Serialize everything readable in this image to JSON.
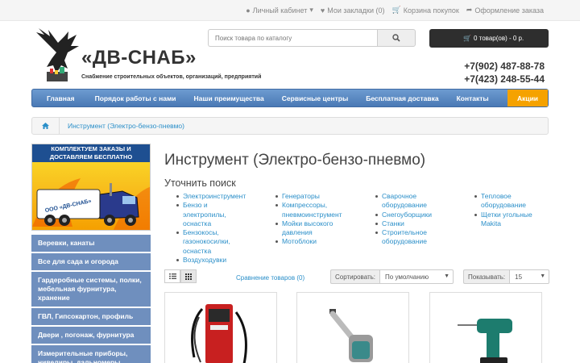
{
  "topbar": {
    "account": "Личный кабинет",
    "wishlist": "Мои закладки (0)",
    "cart": "Корзина покупок",
    "checkout": "Оформление заказа"
  },
  "header": {
    "logo_title": "«ДВ-СНАБ»",
    "logo_subtitle": "Снабжение строительных объектов, организаций, предприятий",
    "search_placeholder": "Поиск товара по каталогу",
    "cart_button": "0 товар(ов) - 0 р.",
    "phone1": "+7(902) 487-88-78",
    "phone2": "+7(423) 248-55-44"
  },
  "nav": [
    "Главная",
    "Порядок работы с нами",
    "Наши преимущества",
    "Сервисные центры",
    "Бесплатная доставка",
    "Контакты",
    "Акции"
  ],
  "breadcrumb": {
    "current": "Инструмент (Электро-бензо-пневмо)"
  },
  "banner": {
    "line1": "КОМПЛЕКТУЕМ ЗАКАЗЫ И",
    "line2": "ДОСТАВЛЯЕМ БЕСПЛАТНО",
    "truck_text": "ООО «ДВ-СНАБ»"
  },
  "sidebar": [
    "Веревки, канаты",
    "Все для сада и огорода",
    "Гардеробные системы, полки, мебельная фурнитура, хранение",
    "ГВЛ, Гипсокартон, профиль",
    "Двери , погонаж, фурнитура",
    "Измерительные приборы, нивелиры, дальномеры"
  ],
  "main": {
    "title": "Инструмент (Электро-бензо-пневмо)",
    "refine_title": "Уточнить поиск",
    "refine_cols": [
      [
        "Электроинструмент",
        "Бензо и электропилы, оснастка",
        "Бензокосы, газонокосилки, оснастка",
        "Воздуходувки"
      ],
      [
        "Генераторы",
        "Компрессоры, пневмоинструмент",
        "Мойки высокого давления",
        "Мотоблоки"
      ],
      [
        "Сварочное оборудование",
        "Снегоуборщики",
        "Станки",
        "Строительное оборудование"
      ],
      [
        "Тепловое оборудование",
        "Щетки угольные Makita"
      ]
    ],
    "compare": "Сравнение товаров (0)",
    "sort_label": "Сортировать:",
    "sort_value": "По умолчанию",
    "limit_label": "Показывать:",
    "limit_value": "15"
  },
  "colors": {
    "nav": "#5a89c4",
    "promo": "#f5a200",
    "link": "#2b8fc9",
    "sidebar": "#6f8fbe"
  }
}
